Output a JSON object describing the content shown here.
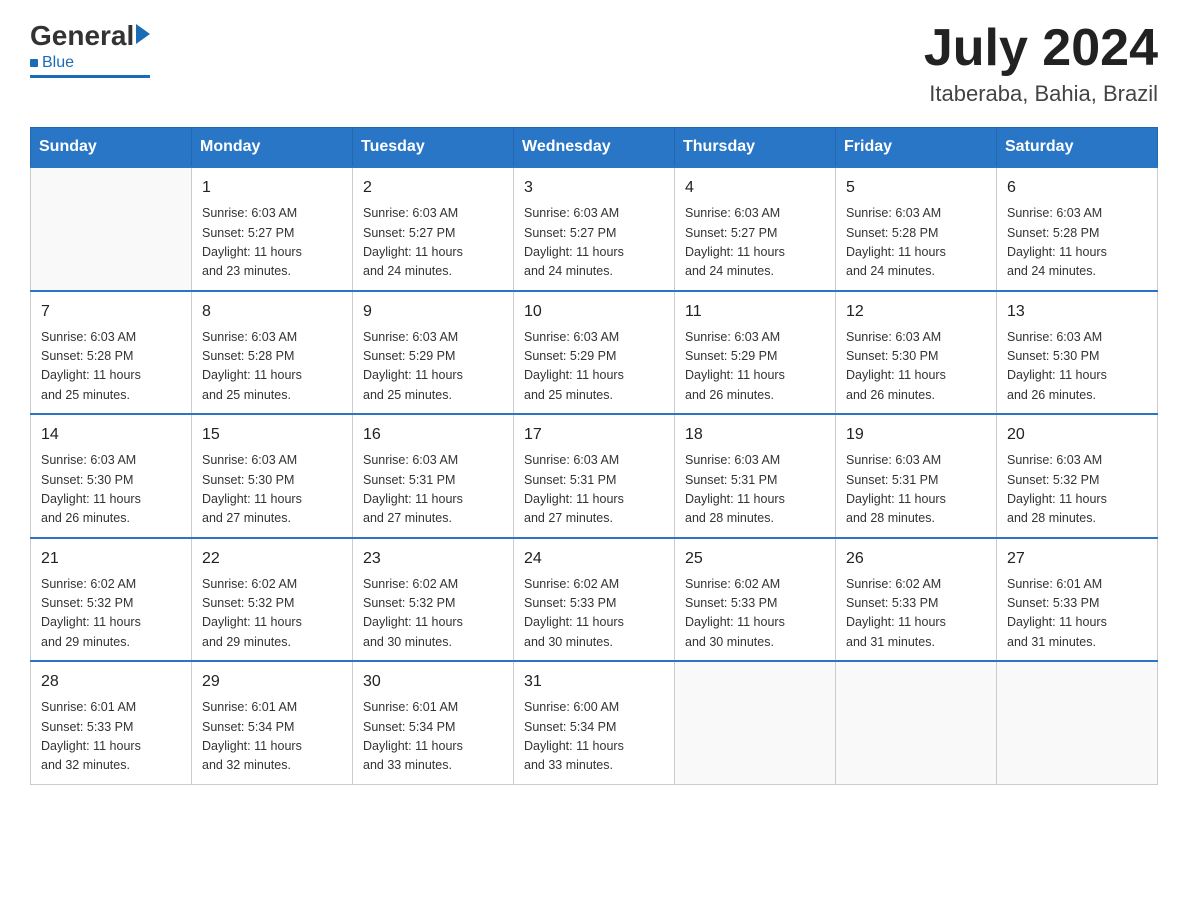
{
  "header": {
    "logo_general": "General",
    "logo_blue": "Blue",
    "month_title": "July 2024",
    "location": "Itaberaba, Bahia, Brazil"
  },
  "days_of_week": [
    "Sunday",
    "Monday",
    "Tuesday",
    "Wednesday",
    "Thursday",
    "Friday",
    "Saturday"
  ],
  "weeks": [
    [
      {
        "day": "",
        "info": ""
      },
      {
        "day": "1",
        "info": "Sunrise: 6:03 AM\nSunset: 5:27 PM\nDaylight: 11 hours\nand 23 minutes."
      },
      {
        "day": "2",
        "info": "Sunrise: 6:03 AM\nSunset: 5:27 PM\nDaylight: 11 hours\nand 24 minutes."
      },
      {
        "day": "3",
        "info": "Sunrise: 6:03 AM\nSunset: 5:27 PM\nDaylight: 11 hours\nand 24 minutes."
      },
      {
        "day": "4",
        "info": "Sunrise: 6:03 AM\nSunset: 5:27 PM\nDaylight: 11 hours\nand 24 minutes."
      },
      {
        "day": "5",
        "info": "Sunrise: 6:03 AM\nSunset: 5:28 PM\nDaylight: 11 hours\nand 24 minutes."
      },
      {
        "day": "6",
        "info": "Sunrise: 6:03 AM\nSunset: 5:28 PM\nDaylight: 11 hours\nand 24 minutes."
      }
    ],
    [
      {
        "day": "7",
        "info": "Sunrise: 6:03 AM\nSunset: 5:28 PM\nDaylight: 11 hours\nand 25 minutes."
      },
      {
        "day": "8",
        "info": "Sunrise: 6:03 AM\nSunset: 5:28 PM\nDaylight: 11 hours\nand 25 minutes."
      },
      {
        "day": "9",
        "info": "Sunrise: 6:03 AM\nSunset: 5:29 PM\nDaylight: 11 hours\nand 25 minutes."
      },
      {
        "day": "10",
        "info": "Sunrise: 6:03 AM\nSunset: 5:29 PM\nDaylight: 11 hours\nand 25 minutes."
      },
      {
        "day": "11",
        "info": "Sunrise: 6:03 AM\nSunset: 5:29 PM\nDaylight: 11 hours\nand 26 minutes."
      },
      {
        "day": "12",
        "info": "Sunrise: 6:03 AM\nSunset: 5:30 PM\nDaylight: 11 hours\nand 26 minutes."
      },
      {
        "day": "13",
        "info": "Sunrise: 6:03 AM\nSunset: 5:30 PM\nDaylight: 11 hours\nand 26 minutes."
      }
    ],
    [
      {
        "day": "14",
        "info": "Sunrise: 6:03 AM\nSunset: 5:30 PM\nDaylight: 11 hours\nand 26 minutes."
      },
      {
        "day": "15",
        "info": "Sunrise: 6:03 AM\nSunset: 5:30 PM\nDaylight: 11 hours\nand 27 minutes."
      },
      {
        "day": "16",
        "info": "Sunrise: 6:03 AM\nSunset: 5:31 PM\nDaylight: 11 hours\nand 27 minutes."
      },
      {
        "day": "17",
        "info": "Sunrise: 6:03 AM\nSunset: 5:31 PM\nDaylight: 11 hours\nand 27 minutes."
      },
      {
        "day": "18",
        "info": "Sunrise: 6:03 AM\nSunset: 5:31 PM\nDaylight: 11 hours\nand 28 minutes."
      },
      {
        "day": "19",
        "info": "Sunrise: 6:03 AM\nSunset: 5:31 PM\nDaylight: 11 hours\nand 28 minutes."
      },
      {
        "day": "20",
        "info": "Sunrise: 6:03 AM\nSunset: 5:32 PM\nDaylight: 11 hours\nand 28 minutes."
      }
    ],
    [
      {
        "day": "21",
        "info": "Sunrise: 6:02 AM\nSunset: 5:32 PM\nDaylight: 11 hours\nand 29 minutes."
      },
      {
        "day": "22",
        "info": "Sunrise: 6:02 AM\nSunset: 5:32 PM\nDaylight: 11 hours\nand 29 minutes."
      },
      {
        "day": "23",
        "info": "Sunrise: 6:02 AM\nSunset: 5:32 PM\nDaylight: 11 hours\nand 30 minutes."
      },
      {
        "day": "24",
        "info": "Sunrise: 6:02 AM\nSunset: 5:33 PM\nDaylight: 11 hours\nand 30 minutes."
      },
      {
        "day": "25",
        "info": "Sunrise: 6:02 AM\nSunset: 5:33 PM\nDaylight: 11 hours\nand 30 minutes."
      },
      {
        "day": "26",
        "info": "Sunrise: 6:02 AM\nSunset: 5:33 PM\nDaylight: 11 hours\nand 31 minutes."
      },
      {
        "day": "27",
        "info": "Sunrise: 6:01 AM\nSunset: 5:33 PM\nDaylight: 11 hours\nand 31 minutes."
      }
    ],
    [
      {
        "day": "28",
        "info": "Sunrise: 6:01 AM\nSunset: 5:33 PM\nDaylight: 11 hours\nand 32 minutes."
      },
      {
        "day": "29",
        "info": "Sunrise: 6:01 AM\nSunset: 5:34 PM\nDaylight: 11 hours\nand 32 minutes."
      },
      {
        "day": "30",
        "info": "Sunrise: 6:01 AM\nSunset: 5:34 PM\nDaylight: 11 hours\nand 33 minutes."
      },
      {
        "day": "31",
        "info": "Sunrise: 6:00 AM\nSunset: 5:34 PM\nDaylight: 11 hours\nand 33 minutes."
      },
      {
        "day": "",
        "info": ""
      },
      {
        "day": "",
        "info": ""
      },
      {
        "day": "",
        "info": ""
      }
    ]
  ]
}
